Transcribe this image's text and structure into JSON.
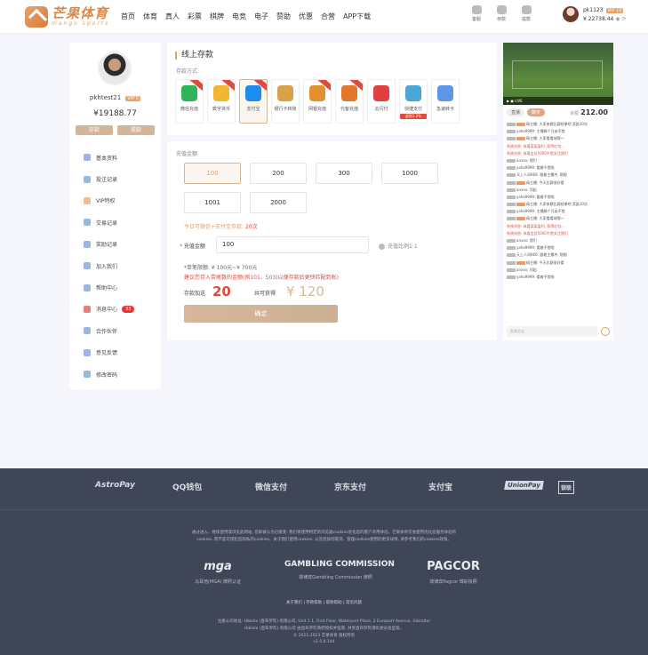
{
  "header": {
    "logo_cn": "芒果体育",
    "logo_en": "mango sports",
    "nav": [
      "首页",
      "体育",
      "真人",
      "彩票",
      "棋牌",
      "电竞",
      "电子",
      "赞助",
      "优惠",
      "合营",
      "APP下载"
    ],
    "icons": [
      {
        "label": "客服",
        "icon": "headset-icon"
      },
      {
        "label": "存款",
        "icon": "wallet-icon"
      },
      {
        "label": "提款",
        "icon": "card-icon"
      }
    ],
    "user": {
      "name": "pk1123",
      "vip": "VIP 10",
      "balance": "¥ 22738.44"
    }
  },
  "profile": {
    "username": "pkhtest21",
    "vip": "VIP 5",
    "balance": "¥19188.77",
    "deposit_btn": "存款",
    "withdraw_btn": "提款",
    "menu": [
      {
        "label": "基本资料",
        "icon": "user-icon"
      },
      {
        "label": "投注记录",
        "icon": "bet-record-icon"
      },
      {
        "label": "VIP特权",
        "icon": "vip-icon"
      },
      {
        "label": "交易记录",
        "icon": "transaction-icon"
      },
      {
        "label": "奖励记录",
        "icon": "reward-icon"
      },
      {
        "label": "加入我们",
        "icon": "join-icon"
      },
      {
        "label": "帮助中心",
        "icon": "help-icon"
      },
      {
        "label": "消息中心",
        "icon": "message-icon",
        "badge": "33"
      },
      {
        "label": "合作伙伴",
        "icon": "partner-icon"
      },
      {
        "label": "意见反馈",
        "icon": "feedback-icon"
      },
      {
        "label": "修改密码",
        "icon": "password-icon"
      }
    ]
  },
  "deposit": {
    "title": "线上存款",
    "method_label": "存款方式",
    "methods": [
      {
        "label": "微信充值",
        "color": "#2fb45a"
      },
      {
        "label": "数字货币",
        "color": "#f2b632"
      },
      {
        "label": "支付宝",
        "color": "#1c8cf0"
      },
      {
        "label": "银行卡转账",
        "color": "#d9a14a"
      },
      {
        "label": "网银充值",
        "color": "#e3902f"
      },
      {
        "label": "代客充值",
        "color": "#e2772d"
      },
      {
        "label": "云闪付",
        "color": "#e23f3f"
      },
      {
        "label": "快捷支付",
        "color": "#4aa7d8",
        "sub": "返利1.2%"
      },
      {
        "label": "急速转卡",
        "color": "#5c97e8"
      }
    ],
    "amount_label": "充值金额",
    "amounts": [
      "100",
      "200",
      "300",
      "1000",
      "1001",
      "2000"
    ],
    "today_prefix": "今日可微信+支付宝存款:",
    "today_count": "20次",
    "input_label": "充值金额",
    "input_value": "100",
    "ratio_label": "充值比例1:1",
    "limit_text": "*单笔限额: ¥ 100元~¥ 700元",
    "suggest_text": "建议您存入带尾数的金额(例101、503)以便存款后更快匹配到账)",
    "bonus_label": "存款加送",
    "bonus_value": "20",
    "total_label": "共可获得",
    "total_value": "¥ 120",
    "confirm": "确定"
  },
  "chat": {
    "video_caption": "LIVE",
    "tabs": [
      "直播",
      "聊天"
    ],
    "balance_label": "余额",
    "balance": "212.00",
    "input_placeholder": "发表言论",
    "messages": [
      {
        "tags": 2,
        "text": "搞主播: 大家来猜比赛结果吧 奖励10次",
        "sys": false
      },
      {
        "tags": 1,
        "text": "yaho9999: 主播踢个兄弟不错",
        "sys": false
      },
      {
        "tags": 2,
        "text": "搞主播: 大家看看球哦～",
        "sys": false
      },
      {
        "tags": 0,
        "text": "系统消息: 恭喜某某盈利, 获得红包...",
        "sys": true
      },
      {
        "tags": 0,
        "text": "系统消息: 恭喜会员5000不错关注我们",
        "sys": true
      },
      {
        "tags": 1,
        "text": "anxxx: 我们",
        "sys": false
      },
      {
        "tags": 1,
        "text": "yaho9999: 看着不错啦",
        "sys": false
      },
      {
        "tags": 1,
        "text": "天上人间666: 跟着主播冲, 稳稳",
        "sys": false
      },
      {
        "tags": 2,
        "text": "搞主播: 今天比赛很好看",
        "sys": false
      },
      {
        "tags": 1,
        "text": "anxxx: 顶起",
        "sys": false
      },
      {
        "tags": 1,
        "text": "yaho9999: 看着不错啦",
        "sys": false
      },
      {
        "tags": 2,
        "text": "搞主播: 大家来猜比赛结果吧 奖励10次",
        "sys": false
      },
      {
        "tags": 1,
        "text": "yaho9999: 主播踢个兄弟不错",
        "sys": false
      },
      {
        "tags": 2,
        "text": "搞主播: 大家看看球哦～",
        "sys": false
      },
      {
        "tags": 0,
        "text": "系统消息: 恭喜某某盈利, 获得红包...",
        "sys": true
      },
      {
        "tags": 0,
        "text": "系统消息: 恭喜会员5000不错关注我们",
        "sys": true
      },
      {
        "tags": 1,
        "text": "anxxx: 我们",
        "sys": false
      },
      {
        "tags": 1,
        "text": "yaho9999: 看着不错啦",
        "sys": false
      },
      {
        "tags": 1,
        "text": "天上人间666: 跟着主播冲, 稳稳",
        "sys": false
      },
      {
        "tags": 2,
        "text": "搞主播: 今天比赛很好看",
        "sys": false
      },
      {
        "tags": 1,
        "text": "anxxx: 顶起",
        "sys": false
      },
      {
        "tags": 1,
        "text": "yaho9999: 看着不错啦",
        "sys": false
      }
    ]
  },
  "footer": {
    "payments": [
      "AstroPay",
      "QQ钱包",
      "微信支付",
      "京东支付",
      "支付宝",
      "UnionPay",
      "银联"
    ],
    "disclaimer1": "通过进入、继续使用或浏览此网站, 您即被认为已接受: 我们将使用特定的浏览器cookies优化您的客户享用体验。芒果体育仅会使用优化您服务体验的",
    "disclaimer2": "cookies, 而不是可侵犯您隐私的cookies。关于我们使用cookies, 以及您如何取消、管理cookies使用的更多详情, 请参考我们的cookies政策。",
    "licenses": [
      {
        "name": "mga",
        "sub": "马耳他(MGA) 牌照认证"
      },
      {
        "name": "GAMBLING COMMISSION",
        "sub": "菲律宾Gambling Commission 牌照"
      },
      {
        "name": "PAGCOR",
        "sub": "菲律宾Pagcor 博彩执照"
      }
    ],
    "links": "关于我们 | 存款帮助 | 取款帮助 | 常见问题",
    "address": "注册公司地址: Hibiola (直布罗陀) 有限公司, Unit 1.1, First Floor, Waterport Place, 2 Europort Avenue, Gibraltar",
    "regulation": "Hibiola (直布罗陀) 有限公司 由直布罗陀政府授权并监管, 并受直布罗陀博彩委员会监管。",
    "copyright": "© 2021-2023 芒果体育 版权所有",
    "version": "v1.0.0.144"
  }
}
